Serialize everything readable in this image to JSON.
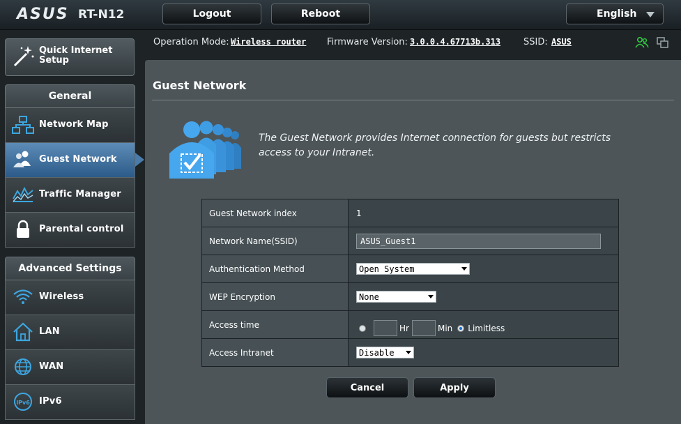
{
  "header": {
    "logo": "ASUS",
    "model": "RT-N12",
    "logout_label": "Logout",
    "reboot_label": "Reboot",
    "language": "English"
  },
  "status": {
    "operation_mode_label": "Operation Mode:",
    "operation_mode_value": "Wireless router",
    "firmware_label": "Firmware Version:",
    "firmware_value": "3.0.0.4.67713b.313",
    "ssid_label": "SSID:",
    "ssid_value": "ASUS"
  },
  "sidebar": {
    "quick_setup": "Quick Internet Setup",
    "general_title": "General",
    "general_items": [
      "Network Map",
      "Guest Network",
      "Traffic Manager",
      "Parental control"
    ],
    "advanced_title": "Advanced Settings",
    "advanced_items": [
      "Wireless",
      "LAN",
      "WAN",
      "IPv6"
    ],
    "active_item": "Guest Network"
  },
  "page": {
    "title": "Guest Network",
    "description": "The Guest Network provides Internet connection for guests but restricts access to your Intranet."
  },
  "form": {
    "index_label": "Guest Network index",
    "index_value": "1",
    "ssid_label": "Network Name(SSID)",
    "ssid_value": "ASUS_Guest1",
    "auth_label": "Authentication Method",
    "auth_value": "Open System",
    "wep_label": "WEP Encryption",
    "wep_value": "None",
    "access_time_label": "Access time",
    "hr_label": "Hr",
    "min_label": "Min",
    "limitless_label": "Limitless",
    "access_time_selected": "Limitless",
    "intranet_label": "Access Intranet",
    "intranet_value": "Disable"
  },
  "actions": {
    "cancel_label": "Cancel",
    "apply_label": "Apply"
  },
  "colors": {
    "active_menu": "#4a7ba9",
    "accent_icon": "#3da6e0",
    "status_green": "#2ecc40"
  }
}
